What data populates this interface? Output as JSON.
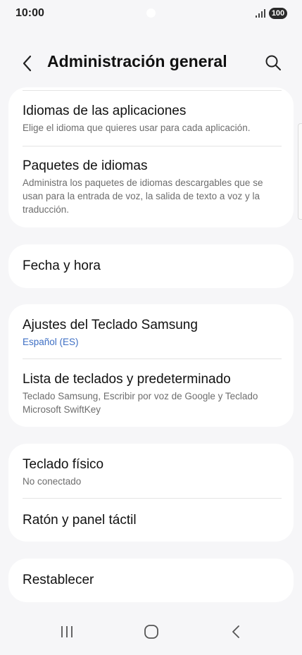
{
  "status_bar": {
    "time": "10:00",
    "battery": "100",
    "signal_icon": "signal-bars-icon"
  },
  "header": {
    "title": "Administración general",
    "back_icon": "chevron-left-icon",
    "search_icon": "search-icon"
  },
  "cards": {
    "languages": {
      "app_languages": {
        "title": "Idiomas de las aplicaciones",
        "subtitle": "Elige el idioma que quieres usar para cada aplicación."
      },
      "language_packs": {
        "title": "Paquetes de idiomas",
        "subtitle": "Administra los paquetes de idiomas descargables que se usan para la entrada de voz, la salida de texto a voz y la traducción."
      }
    },
    "date_time": {
      "title": "Fecha y hora"
    },
    "keyboards": {
      "samsung_keyboard": {
        "title": "Ajustes del Teclado Samsung",
        "subtitle": "Español (ES)"
      },
      "keyboard_list": {
        "title": "Lista de teclados y predeterminado",
        "subtitle": "Teclado Samsung, Escribir por voz de Google y Teclado Microsoft SwiftKey"
      }
    },
    "input_devices": {
      "physical_keyboard": {
        "title": "Teclado físico",
        "subtitle": "No conectado"
      },
      "mouse_trackpad": {
        "title": "Ratón y panel táctil"
      }
    },
    "reset": {
      "title": "Restablecer"
    }
  },
  "nav_bar": {
    "recents_icon": "recents-icon",
    "home_icon": "home-icon",
    "back_icon": "back-icon"
  },
  "colors": {
    "background": "#f6f6f8",
    "card": "#ffffff",
    "accent": "#3e6fc4",
    "subtitle": "#6d6d6d"
  }
}
